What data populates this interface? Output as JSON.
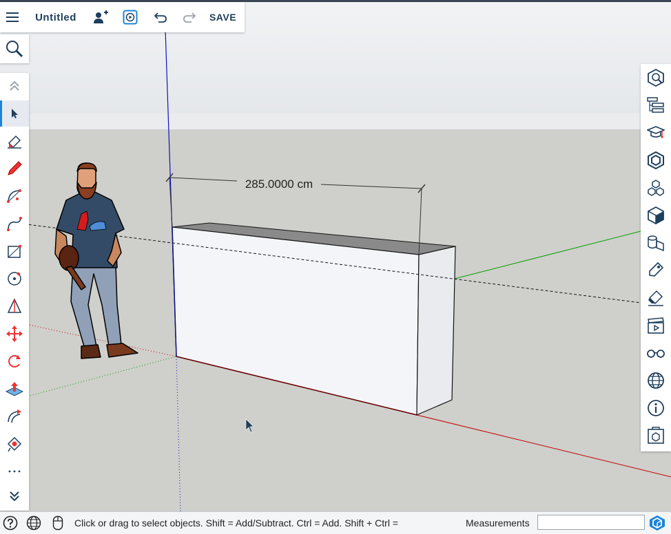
{
  "app": {
    "title": "Untitled",
    "save_label": "SAVE"
  },
  "viewport": {
    "dimension_text": "285.0000 cm",
    "colors": {
      "sky": "#e8ebee",
      "ground": "#cfcfcb",
      "red_axis": "#c00000",
      "green_axis": "#00a000",
      "blue_axis": "#1010c0",
      "box_front": "#f4f5f8",
      "box_side": "#e9ebee",
      "box_top": "#8a8a8a"
    }
  },
  "left_toolbar": {
    "tools": [
      {
        "name": "collapse-up",
        "icon": "chevron-up-icon"
      },
      {
        "name": "select",
        "icon": "select-arrow-icon",
        "active": true
      },
      {
        "name": "eraser",
        "icon": "eraser-icon"
      },
      {
        "name": "pencil",
        "icon": "pencil-icon"
      },
      {
        "name": "arc",
        "icon": "arc-icon"
      },
      {
        "name": "freehand",
        "icon": "freehand-icon"
      },
      {
        "name": "rectangle",
        "icon": "rectangle-icon"
      },
      {
        "name": "circle",
        "icon": "circle-icon"
      },
      {
        "name": "polygon",
        "icon": "polygon-icon"
      },
      {
        "name": "move",
        "icon": "move-icon"
      },
      {
        "name": "rotate",
        "icon": "rotate-icon"
      },
      {
        "name": "push-pull",
        "icon": "push-pull-icon"
      },
      {
        "name": "follow-me",
        "icon": "follow-me-icon"
      },
      {
        "name": "paint-bucket",
        "icon": "paint-bucket-icon"
      },
      {
        "name": "more",
        "icon": "more-icon"
      },
      {
        "name": "collapse-down",
        "icon": "chevron-down-icon"
      }
    ]
  },
  "right_toolbar": {
    "panels": [
      "entity-info-icon",
      "outliner-icon",
      "instructor-icon",
      "components-icon",
      "materials-icon",
      "styles-icon",
      "tags-icon",
      "soften-icon",
      "eraser-panel-icon",
      "scenes-icon",
      "display-icon",
      "geo-location-icon",
      "info-icon",
      "solid-inspector-icon"
    ]
  },
  "status": {
    "hint": "Click or drag to select objects. Shift = Add/Subtract. Ctrl = Add. Shift + Ctrl =",
    "measurements_label": "Measurements",
    "measurements_value": ""
  }
}
